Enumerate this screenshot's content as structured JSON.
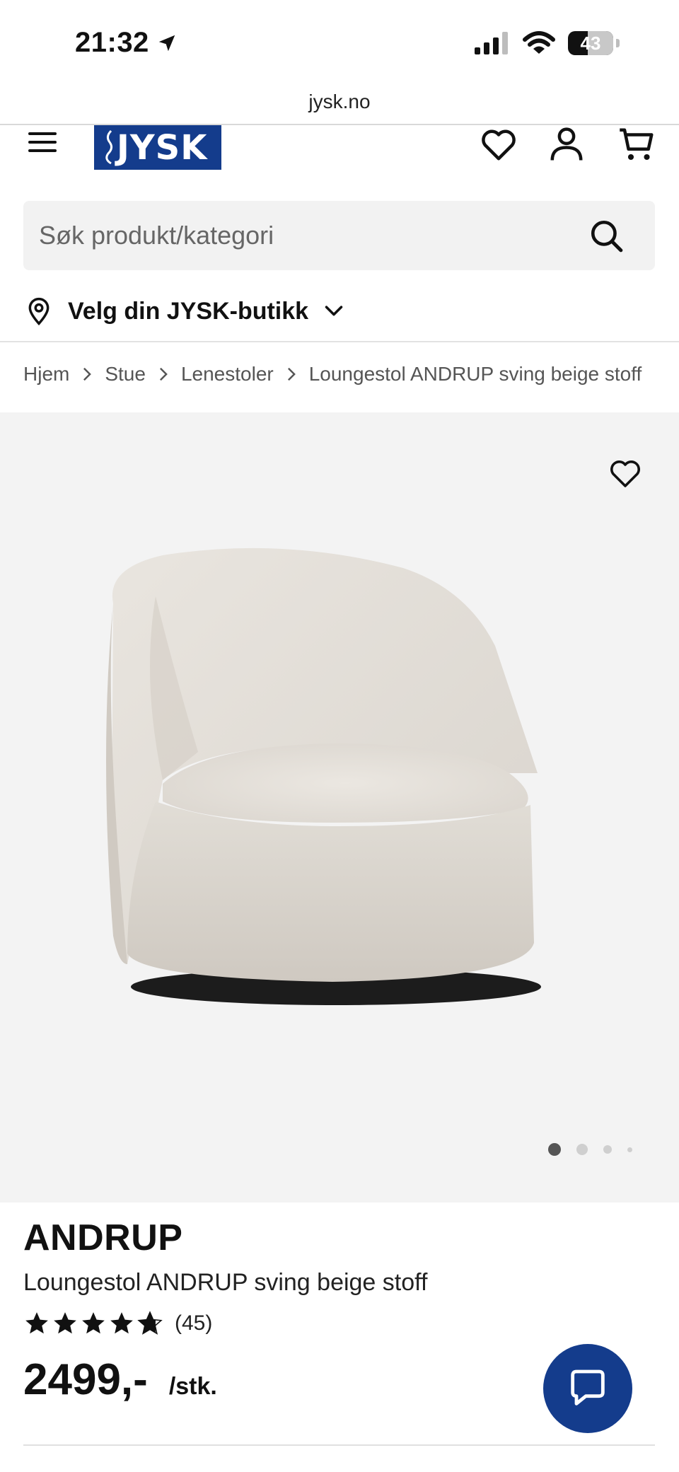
{
  "status_bar": {
    "time": "21:32",
    "battery": "43"
  },
  "browser": {
    "url": "jysk.no"
  },
  "header": {
    "logo_text": "JYSK",
    "icons": [
      "menu-icon",
      "heart-icon",
      "user-icon",
      "cart-icon"
    ]
  },
  "search": {
    "placeholder": "Søk produkt/kategori"
  },
  "store_selector": {
    "label": "Velg din JYSK-butikk"
  },
  "breadcrumb": [
    "Hjem",
    "Stue",
    "Lenestoler",
    "Loungestol ANDRUP sving beige stoff"
  ],
  "gallery": {
    "image_count": 4,
    "active_index": 0
  },
  "product": {
    "brand": "ANDRUP",
    "name": "Loungestol ANDRUP sving beige stoff",
    "rating": 4.7,
    "rating_max": 5,
    "review_count": "(45)",
    "price": "2499,-",
    "unit": "/stk."
  },
  "colors": {
    "brand_blue": "#143c8c",
    "gallery_bg": "#f3f3f3",
    "text": "#111111"
  }
}
